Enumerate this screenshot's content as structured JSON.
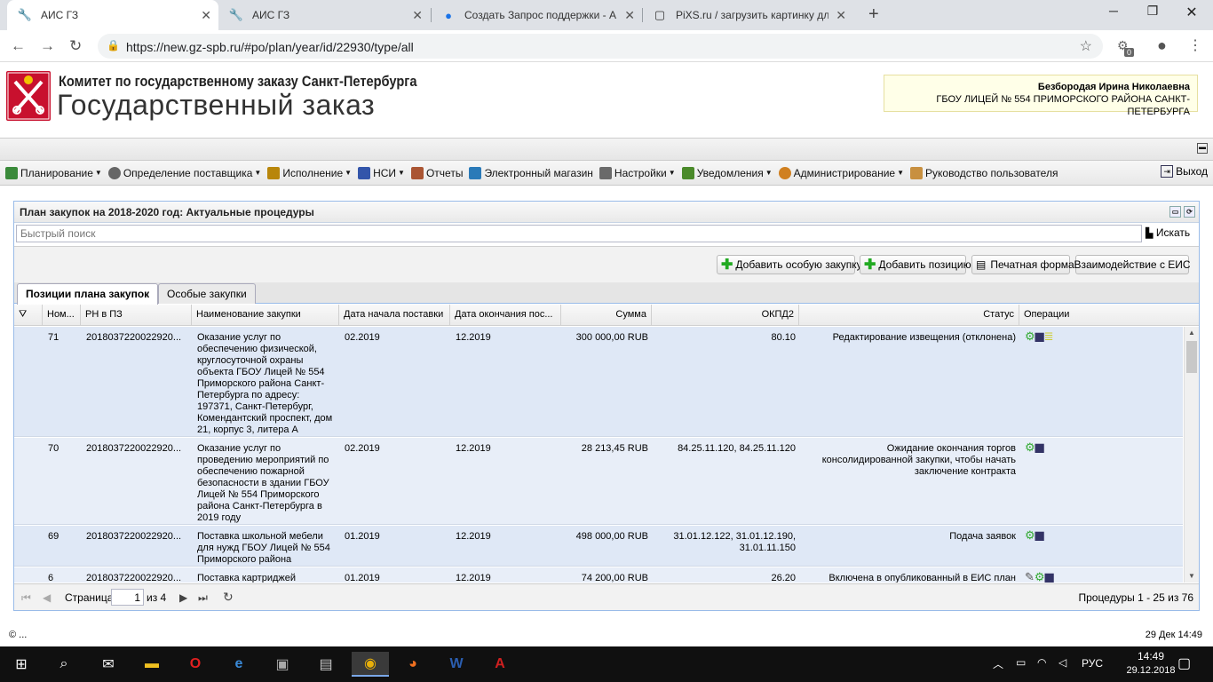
{
  "browser": {
    "tabs": [
      {
        "title": "АИС ГЗ",
        "active": true
      },
      {
        "title": "АИС ГЗ",
        "active": false
      },
      {
        "title": "Создать Запрос поддержки - А",
        "active": false
      },
      {
        "title": "PiXS.ru / загрузить картинку дл",
        "active": false
      }
    ],
    "url": "https://new.gz-spb.ru/#po/plan/year/id/22930/type/all",
    "ext_badge": "0"
  },
  "site": {
    "org": "Комитет по государственному заказу Санкт-Петербурга",
    "title": "Государственный заказ",
    "user_name": "Безбородая Ирина Николаевна",
    "user_org": "ГБОУ ЛИЦЕЙ № 554 ПРИМОРСКОГО РАЙОНА САНКТ-ПЕТЕРБУРГА"
  },
  "menu": {
    "items": [
      {
        "label": "Планирование",
        "dropdown": true,
        "color": "#3a8a3a"
      },
      {
        "label": "Определение поставщика",
        "dropdown": true,
        "color": "#666666"
      },
      {
        "label": "Исполнение",
        "dropdown": true,
        "color": "#b8860b"
      },
      {
        "label": "НСИ",
        "dropdown": true,
        "color": "#3355aa"
      },
      {
        "label": "Отчеты",
        "dropdown": false,
        "color": "#aa5533"
      },
      {
        "label": "Электронный магазин",
        "dropdown": false,
        "color": "#2a7ab8"
      },
      {
        "label": "Настройки",
        "dropdown": true,
        "color": "#6a6a6a"
      },
      {
        "label": "Уведомления",
        "dropdown": true,
        "color": "#4a8a2a"
      },
      {
        "label": "Администрирование",
        "dropdown": true,
        "color": "#d08020"
      },
      {
        "label": "Руководство пользователя",
        "dropdown": false,
        "color": "#c89040"
      }
    ],
    "exit": "Выход"
  },
  "panel": {
    "title": "План закупок на 2018-2020 год: Актуальные процедуры",
    "search_placeholder": "Быстрый поиск",
    "search_button": "Искать",
    "buttons": {
      "add_special": "Добавить особую закупку",
      "add_position": "Добавить позицию",
      "print": "Печатная форма",
      "eis": "Взаимодействие с ЕИС"
    },
    "tabs": [
      "Позиции плана закупок",
      "Особые закупки"
    ]
  },
  "grid": {
    "columns": [
      "Ном...",
      "РН в ПЗ",
      "Наименование закупки",
      "Дата начала поставки",
      "Дата окончания пос...",
      "Сумма",
      "ОКПД2",
      "Статус",
      "Операции"
    ],
    "rows": [
      {
        "num": "71",
        "rn": "2018037220022920...",
        "name": "Оказание услуг по обеспечению физической, круглосуточной охраны объекта ГБОУ Лицей № 554 Приморского района Санкт-Петербурга по адресу: 197371, Санкт-Петербург, Комендантский проспект, дом 21, корпус 3, литера А",
        "start": "02.2019",
        "end": "12.2019",
        "sum": "300 000,00 RUB",
        "okpd": "80.10",
        "status": "Редактирование извещения (отклонена)"
      },
      {
        "num": "70",
        "rn": "2018037220022920...",
        "name": "Оказание услуг по проведению мероприятий по обеспечению пожарной безопасности в здании ГБОУ Лицей № 554 Приморского района Санкт-Петербурга в 2019 году",
        "start": "02.2019",
        "end": "12.2019",
        "sum": "28 213,45 RUB",
        "okpd": "84.25.11.120, 84.25.11.120",
        "status": "Ожидание окончания торгов консолидированной закупки, чтобы начать заключение контракта"
      },
      {
        "num": "69",
        "rn": "2018037220022920...",
        "name": "Поставка школьной мебели для нужд ГБОУ Лицей № 554 Приморского района",
        "start": "01.2019",
        "end": "12.2019",
        "sum": "498 000,00 RUB",
        "okpd": "31.01.12.122, 31.01.12.190, 31.01.11.150",
        "status": "Подача заявок"
      },
      {
        "num": "6",
        "rn": "2018037220022920...",
        "name": "Поставка картриджей",
        "start": "01.2019",
        "end": "12.2019",
        "sum": "74 200,00 RUB",
        "okpd": "26.20",
        "status": "Включена в опубликованный в ЕИС план"
      }
    ]
  },
  "pager": {
    "page_label": "Страница",
    "page": "1",
    "of": "из 4",
    "summary": "Процедуры 1 - 25 из 76"
  },
  "footer": {
    "copyright": "© ...",
    "datetime": "29 Дек 14:49"
  },
  "taskbar": {
    "time": "14:49",
    "date": "29.12.2018",
    "lang": "РУС"
  }
}
